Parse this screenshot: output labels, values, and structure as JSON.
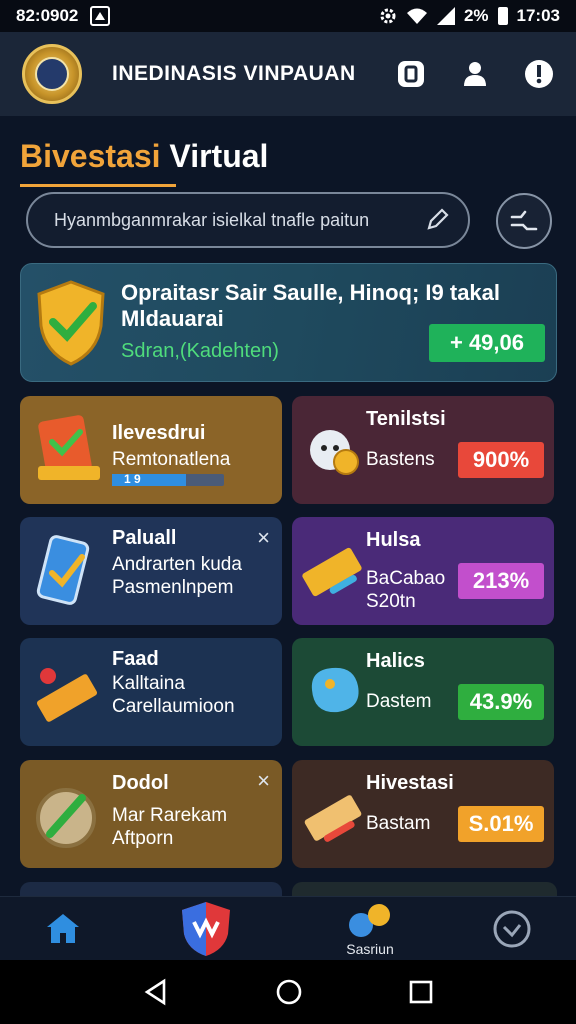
{
  "status_bar": {
    "time_left": "82:0902",
    "battery": "2%",
    "time_right": "17:03"
  },
  "app_bar": {
    "title": "INEDINASIS VINPAUAN",
    "actions": [
      "document-icon",
      "user-icon",
      "info-icon"
    ]
  },
  "section": {
    "title_accent": "Bivestasi",
    "title_rest": " Virtual"
  },
  "search": {
    "placeholder": "Hyanmbganmrakar isielkal tnafle paitun"
  },
  "hero": {
    "title": "Opraitasr Sair Saulle, Hinoq; I9 takal Mldauarai",
    "subtitle": "Sdran,(Kadehten)",
    "value": "+ 49,06"
  },
  "cards": [
    {
      "title": "Ilevesdrui",
      "line1": "Remtonatlena",
      "line2": "1 9",
      "color": "#8b6428"
    },
    {
      "title": "Tenilstsi",
      "line1": "Bastens",
      "badge": "900%",
      "badge_color": "#e8483a",
      "color": "#4a2636"
    },
    {
      "title": "Paluall",
      "line1": "Andrarten kuda",
      "line2": "Pasmenlnpem",
      "color": "#203458"
    },
    {
      "title": "Hulsa",
      "line1": "BaCabao",
      "line2": "S20tn",
      "badge": "213%",
      "badge_color": "#c24fcc",
      "color": "#4a2a78"
    },
    {
      "title": "Faad",
      "line1": "Kalltaina",
      "line2": "Carellaumioon",
      "color": "#1c3252"
    },
    {
      "title": "Halics",
      "line1": "Dastem",
      "badge": "43.9%",
      "badge_color": "#2fae3f",
      "color": "#1c4a36"
    },
    {
      "title": "Dodol",
      "line1": "Mar Rarekam",
      "line2": "Aftporn",
      "color": "#7a5a26"
    },
    {
      "title": "Hivestasi",
      "line1": "Bastam",
      "badge": "S.01%",
      "badge_color": "#f1a22a",
      "color": "#3d2a24"
    }
  ],
  "bottom_nav": {
    "items": [
      "home-icon",
      "shield-logo-icon",
      "coins-icon",
      "clock-icon"
    ],
    "label": "Sasriun"
  },
  "system_nav": [
    "back-icon",
    "home-circle-icon",
    "recents-icon"
  ]
}
